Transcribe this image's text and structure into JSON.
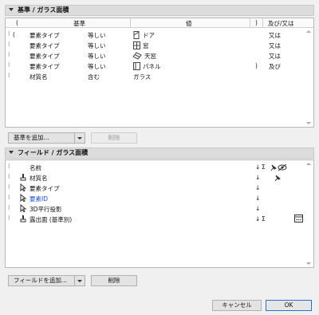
{
  "criteria_section": {
    "title": "基準 / ガラス面積",
    "columns": {
      "paren_open": "(",
      "criteria": "基準",
      "value": "値",
      "paren_close": ")",
      "andor": "及び/又は"
    },
    "rows": [
      {
        "paren_open": "(",
        "criteria": "要素タイプ",
        "op": "等しい",
        "value_icon": "door-icon",
        "value": "ドア",
        "paren_close": "",
        "andor": "又は"
      },
      {
        "paren_open": "",
        "criteria": "要素タイプ",
        "op": "等しい",
        "value_icon": "window-icon",
        "value": "窓",
        "paren_close": "",
        "andor": "又は"
      },
      {
        "paren_open": "",
        "criteria": "要素タイプ",
        "op": "等しい",
        "value_icon": "skylight-icon",
        "value": "天窓",
        "paren_close": "",
        "andor": "又は"
      },
      {
        "paren_open": "",
        "criteria": "要素タイプ",
        "op": "等しい",
        "value_icon": "panel-icon",
        "value": "パネル",
        "paren_close": ")",
        "andor": "及び"
      },
      {
        "paren_open": "",
        "criteria": "材質名",
        "op": "含む",
        "value_icon": "",
        "value": "ガラス",
        "paren_close": "",
        "andor": ""
      }
    ],
    "add_button": "基準を追加...",
    "delete_button": "削除"
  },
  "fields_section": {
    "title": "フィールド / ガラス面積",
    "rows": [
      {
        "icon": "",
        "name": "名前",
        "sort": "↓",
        "sum": "Σ",
        "extra": "pin-hide"
      },
      {
        "icon": "stamp-icon",
        "name": "材質名",
        "sort": "↓",
        "sum": "",
        "extra": "pin"
      },
      {
        "icon": "cursor-icon",
        "name": "要素タイプ",
        "sort": "↓",
        "sum": "",
        "extra": ""
      },
      {
        "icon": "cursor-icon",
        "name": "要素ID",
        "sort": "↓",
        "sum": "",
        "extra": ""
      },
      {
        "icon": "cursor-icon",
        "name": "3D平行投影",
        "sort": "↓",
        "sum": "",
        "extra": ""
      },
      {
        "icon": "stamp-icon",
        "name": "露出面 (基準別)",
        "sort": "↓",
        "sum": "Σ",
        "extra": "more"
      }
    ],
    "add_button": "フィールドを追加...",
    "delete_button": "削除"
  },
  "footer": {
    "cancel": "キャンセル",
    "ok": "OK"
  }
}
